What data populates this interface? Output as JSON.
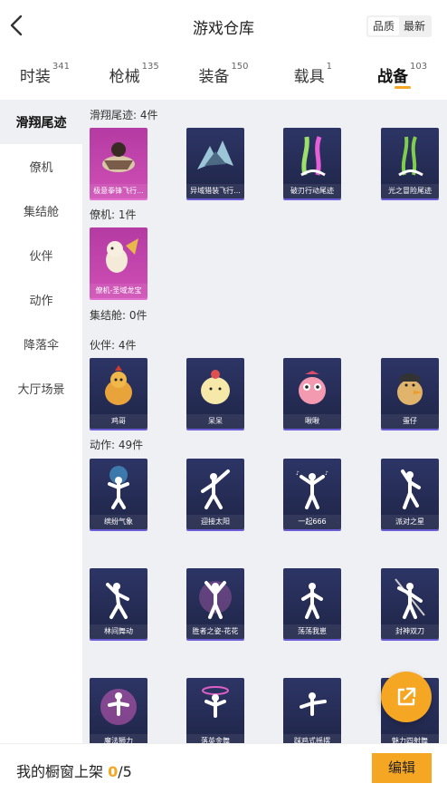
{
  "header": {
    "title": "游戏仓库",
    "sort_quality": "品质",
    "sort_latest": "最新"
  },
  "tabs": [
    {
      "label": "时装",
      "count": "341"
    },
    {
      "label": "枪械",
      "count": "135"
    },
    {
      "label": "装备",
      "count": "150"
    },
    {
      "label": "载具",
      "count": "1"
    },
    {
      "label": "战备",
      "count": "103"
    }
  ],
  "sidebar": [
    "滑翔尾迹",
    "僚机",
    "集结舱",
    "伙伴",
    "动作",
    "降落伞",
    "大厅场景"
  ],
  "sections": {
    "trails": {
      "title": "滑翔尾迹: 4件",
      "items": [
        "极意拳锋飞行...",
        "异域猎装飞行...",
        "破刃行动尾迹",
        "光之冒险尾迹"
      ]
    },
    "wingman": {
      "title": "僚机: 1件",
      "items": [
        "僚机-圣域龙宝"
      ]
    },
    "pod": {
      "title": "集结舱: 0件"
    },
    "partner": {
      "title": "伙伴: 4件",
      "items": [
        "鸡哥",
        "呆呆",
        "啾啾",
        "蛋仔"
      ]
    },
    "emote": {
      "title": "动作: 49件",
      "items": [
        "缤纷气象",
        "迎接太阳",
        "一起666",
        "派对之星",
        "林间舞动",
        "胜者之姿-花花",
        "荡荡我崽",
        "封神双刀",
        "魔法狮力",
        "落英金舞",
        "踩鸡式摇摆",
        "魅力四射舞"
      ]
    }
  },
  "bottom": {
    "shelf_label": "我的橱窗上架 ",
    "shelf_count": "0",
    "shelf_total": "/5",
    "edit_label": "编辑"
  },
  "colors": {
    "accent": "#f5a623",
    "card_bg": "#2d3566",
    "card_legend": "#cf4fb5"
  }
}
